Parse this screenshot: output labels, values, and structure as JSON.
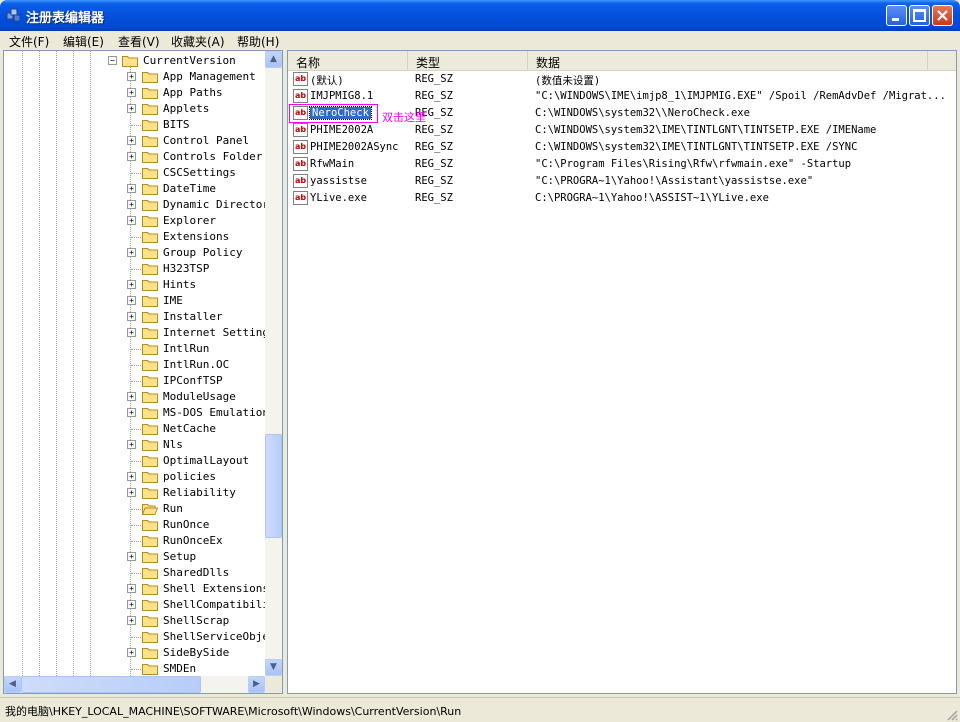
{
  "window": {
    "title": "注册表编辑器"
  },
  "menu": [
    "文件(F)",
    "编辑(E)",
    "查看(V)",
    "收藏夹(A)",
    "帮助(H)"
  ],
  "tree": {
    "root": "CurrentVersion",
    "items": [
      {
        "label": "App Management",
        "expandable": true
      },
      {
        "label": "App Paths",
        "expandable": true
      },
      {
        "label": "Applets",
        "expandable": true
      },
      {
        "label": "BITS",
        "expandable": false
      },
      {
        "label": "Control Panel",
        "expandable": true
      },
      {
        "label": "Controls Folder",
        "expandable": true
      },
      {
        "label": "CSCSettings",
        "expandable": false
      },
      {
        "label": "DateTime",
        "expandable": true
      },
      {
        "label": "Dynamic Directory",
        "expandable": true
      },
      {
        "label": "Explorer",
        "expandable": true
      },
      {
        "label": "Extensions",
        "expandable": false
      },
      {
        "label": "Group Policy",
        "expandable": true
      },
      {
        "label": "H323TSP",
        "expandable": false
      },
      {
        "label": "Hints",
        "expandable": true
      },
      {
        "label": "IME",
        "expandable": true
      },
      {
        "label": "Installer",
        "expandable": true
      },
      {
        "label": "Internet Settings",
        "expandable": true
      },
      {
        "label": "IntlRun",
        "expandable": false
      },
      {
        "label": "IntlRun.OC",
        "expandable": false
      },
      {
        "label": "IPConfTSP",
        "expandable": false
      },
      {
        "label": "ModuleUsage",
        "expandable": true
      },
      {
        "label": "MS-DOS Emulation",
        "expandable": true
      },
      {
        "label": "NetCache",
        "expandable": false
      },
      {
        "label": "Nls",
        "expandable": true
      },
      {
        "label": "OptimalLayout",
        "expandable": false
      },
      {
        "label": "policies",
        "expandable": true
      },
      {
        "label": "Reliability",
        "expandable": true
      },
      {
        "label": "Run",
        "expandable": false,
        "open": true
      },
      {
        "label": "RunOnce",
        "expandable": false
      },
      {
        "label": "RunOnceEx",
        "expandable": false
      },
      {
        "label": "Setup",
        "expandable": true
      },
      {
        "label": "SharedDlls",
        "expandable": false
      },
      {
        "label": "Shell Extensions",
        "expandable": true
      },
      {
        "label": "ShellCompatibilit",
        "expandable": true
      },
      {
        "label": "ShellScrap",
        "expandable": true
      },
      {
        "label": "ShellServiceObjec",
        "expandable": false
      },
      {
        "label": "SideBySide",
        "expandable": true
      },
      {
        "label": "SMDEn",
        "expandable": false
      }
    ]
  },
  "list": {
    "columns": [
      "名称",
      "类型",
      "数据"
    ],
    "rows": [
      {
        "name": "(默认)",
        "type": "REG_SZ",
        "data": "(数值未设置)"
      },
      {
        "name": "IMJPMIG8.1",
        "type": "REG_SZ",
        "data": "\"C:\\WINDOWS\\IME\\imjp8_1\\IMJPMIG.EXE\" /Spoil /RemAdvDef /Migrat..."
      },
      {
        "name": "NeroCheck",
        "type": "REG_SZ",
        "data": "C:\\WINDOWS\\system32\\\\NeroCheck.exe",
        "selected": true
      },
      {
        "name": "PHIME2002A",
        "type": "REG_SZ",
        "data": "C:\\WINDOWS\\system32\\IME\\TINTLGNT\\TINTSETP.EXE /IMEName"
      },
      {
        "name": "PHIME2002ASync",
        "type": "REG_SZ",
        "data": "C:\\WINDOWS\\system32\\IME\\TINTLGNT\\TINTSETP.EXE /SYNC"
      },
      {
        "name": "RfwMain",
        "type": "REG_SZ",
        "data": "\"C:\\Program Files\\Rising\\Rfw\\rfwmain.exe\" -Startup"
      },
      {
        "name": "yassistse",
        "type": "REG_SZ",
        "data": "\"C:\\PROGRA~1\\Yahoo!\\Assistant\\yassistse.exe\""
      },
      {
        "name": "YLive.exe",
        "type": "REG_SZ",
        "data": "C:\\PROGRA~1\\Yahoo!\\ASSIST~1\\YLive.exe"
      }
    ]
  },
  "annotation": {
    "text": "双击这里",
    "color": "#ff00ff"
  },
  "status": {
    "path": "我的电脑\\HKEY_LOCAL_MACHINE\\SOFTWARE\\Microsoft\\Windows\\CurrentVersion\\Run"
  },
  "colors": {
    "titlebar": "#0550dc",
    "selection": "#316ac5",
    "annotation": "#ff00ff"
  }
}
